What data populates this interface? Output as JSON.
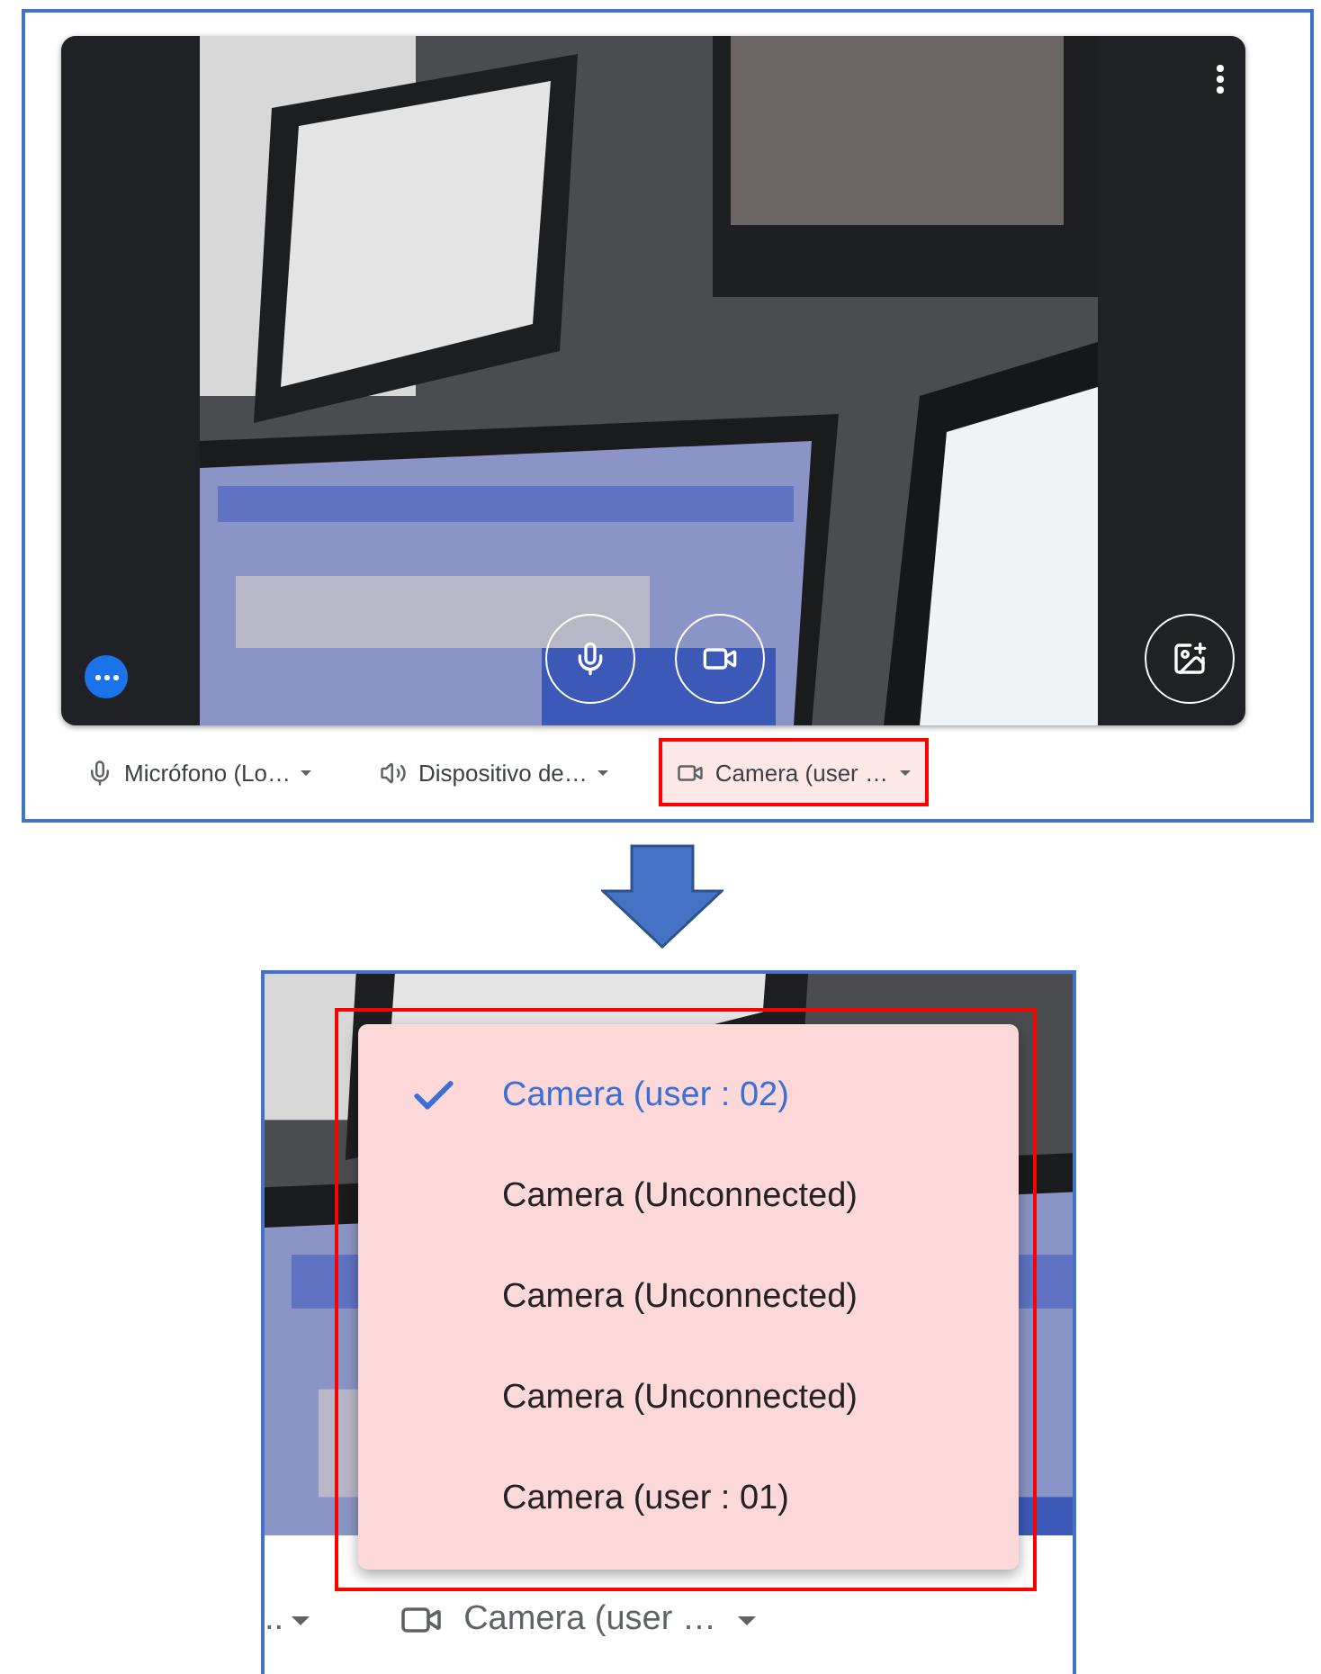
{
  "preview": {
    "devices": [
      {
        "kind": "mic",
        "label": "Micrófono (Lo…",
        "highlighted": false
      },
      {
        "kind": "speaker",
        "label": "Dispositivo de…",
        "highlighted": false
      },
      {
        "kind": "camera",
        "label": "Camera (user …",
        "highlighted": true
      }
    ]
  },
  "zoomed": {
    "left_label": "..",
    "camera_label": "Camera (user …",
    "menu": [
      {
        "label": "Camera (user : 02)",
        "selected": true
      },
      {
        "label": "Camera (Unconnected)",
        "selected": false
      },
      {
        "label": "Camera (Unconnected)",
        "selected": false
      },
      {
        "label": "Camera (Unconnected)",
        "selected": false
      },
      {
        "label": "Camera (user : 01)",
        "selected": false
      }
    ]
  }
}
